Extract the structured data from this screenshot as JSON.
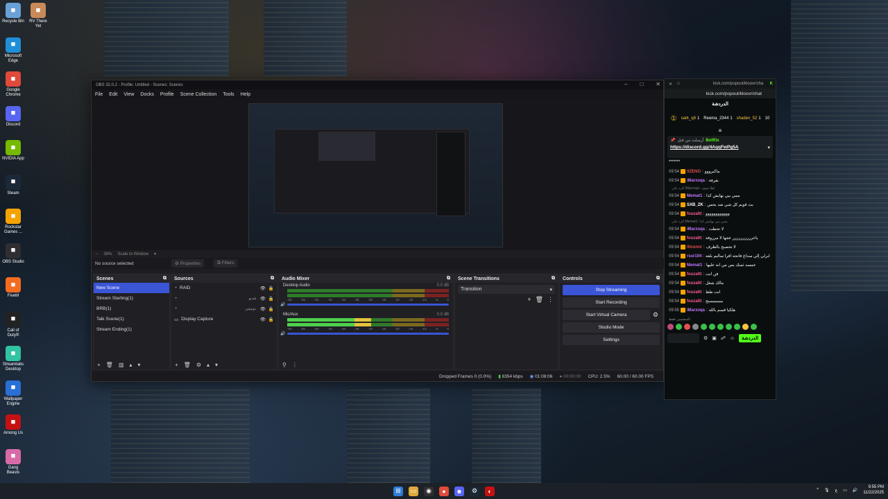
{
  "desktop": {
    "icons": [
      {
        "label": "Recycle Bin",
        "icon": "recycle-bin-icon",
        "color": "#6aa0d8"
      },
      {
        "label": "RV There Yet",
        "icon": "game-icon",
        "color": "#c98a5a"
      },
      {
        "label": "Microsoft Edge",
        "icon": "edge-icon",
        "color": "#1f8fd8"
      },
      {
        "label": "Google Chrome",
        "icon": "chrome-icon",
        "color": "#e04a3a"
      },
      {
        "label": "Discord",
        "icon": "discord-icon",
        "color": "#5865f2"
      },
      {
        "label": "NVIDIA App",
        "icon": "nvidia-icon",
        "color": "#76b900"
      },
      {
        "label": "Steam",
        "icon": "steam-icon",
        "color": "#1b2838"
      },
      {
        "label": "Rockstar Games ...",
        "icon": "rockstar-icon",
        "color": "#f5a300"
      },
      {
        "label": "OBS Studio",
        "icon": "obs-icon",
        "color": "#302e31"
      },
      {
        "label": "FiveM",
        "icon": "fivem-icon",
        "color": "#f36c21"
      },
      {
        "label": "Call of Duty®",
        "icon": "cod-icon",
        "color": "#222222"
      },
      {
        "label": "Streamlabs Desktop",
        "icon": "streamlabs-icon",
        "color": "#31c3a2"
      },
      {
        "label": "Wallpaper Engine",
        "icon": "wallpaper-engine-icon",
        "color": "#2a6fd6"
      },
      {
        "label": "Among Us",
        "icon": "among-us-icon",
        "color": "#c51111"
      },
      {
        "label": "Gang Beasts",
        "icon": "gang-beasts-icon",
        "color": "#d86aa8"
      }
    ]
  },
  "obs": {
    "title": "OBS 32.0.2 - Profile: Untitled - Scenes: Scenes",
    "menu": [
      "File",
      "Edit",
      "View",
      "Docks",
      "Profile",
      "Scene Collection",
      "Tools",
      "Help"
    ],
    "zoom": "38%",
    "scale_mode": "Scale to Window",
    "source_status": "No source selected",
    "properties_label": "Properties",
    "filters_label": "Filters",
    "scenes": {
      "title": "Scenes",
      "items": [
        "New Scene",
        "Stream Starting(1)",
        "BRB(1)",
        "Talk Scene(1)",
        "Stream Ending(1)"
      ],
      "selected": 0
    },
    "sources": {
      "title": "Sources",
      "items": [
        {
          "name": "RAID",
          "tag": ""
        },
        {
          "name": "",
          "tag": "فيديو"
        },
        {
          "name": "",
          "tag": "دونيشن"
        },
        {
          "name": "Display Capture",
          "tag": ""
        }
      ]
    },
    "audio_mixer": {
      "title": "Audio Mixer",
      "channels": [
        {
          "name": "Desktop Audio",
          "db": "0.0 dB",
          "level": 0.0
        },
        {
          "name": "Mic/Aux",
          "db": "0.0 dB",
          "level": 0.52
        }
      ],
      "scale": [
        "-60",
        "-55",
        "-50",
        "-45",
        "-40",
        "-35",
        "-30",
        "-25",
        "-20",
        "-15",
        "-10",
        "-5",
        "0"
      ]
    },
    "scene_transitions": {
      "title": "Scene Transitions",
      "value": "Transition"
    },
    "controls": {
      "title": "Controls",
      "stop_streaming": "Stop Streaming",
      "start_recording": "Start Recording",
      "start_virtual_camera": "Start Virtual Camera",
      "studio_mode": "Studio Mode",
      "settings": "Settings"
    },
    "status": {
      "dropped_frames": "Dropped Frames 0 (0.0%)",
      "bitrate": "8354 kbps",
      "stream_time": "01:08:06",
      "record_time": "00:00:00",
      "cpu": "CPU: 2.5%",
      "fps": "60.00 / 60.00 FPS"
    }
  },
  "chat": {
    "title": "kick.com/popout/kloovr/cha",
    "url": "kick.com/popout/kloovr/chat",
    "header": "الدردشة",
    "top": [
      {
        "name": "sark_q8",
        "count": "1"
      },
      {
        "name": "Reema_2344",
        "count": "1"
      },
      {
        "name": "shaden_52",
        "count": "1"
      }
    ],
    "leader_count": "10",
    "pinned_user": "BotRix",
    "pinned_prefix": "أرسلت من قبل",
    "pinned_link": "https://discord.gg/4AqqFwPg5A",
    "stars": "*******",
    "messages": [
      {
        "time": "09:54",
        "user": "llZENO",
        "color": "#e05050",
        "text": "ماكبرووو",
        "reply": ""
      },
      {
        "time": "09:54",
        "user": "iMarzoqa",
        "color": "#c078ff",
        "text": "بقرفة",
        "reply": ""
      },
      {
        "time": "09:54",
        "user": "Memat1",
        "color": "#c078ff",
        "text": "ممي يبي بهايش كذا",
        "reply": "الرد على iMarzoqa: اهلا ضيف"
      },
      {
        "time": "09:54",
        "user": "SXB_ZK",
        "color": "#ffffff",
        "text": "بث قويم كل شي ضد بحس",
        "reply": ""
      },
      {
        "time": "09:54",
        "user": "fouzaltt",
        "color": "#ff5a9a",
        "text": "وووووووووووو",
        "reply": ""
      },
      {
        "time": "09:54",
        "user": "iMarzoqa",
        "color": "#c078ff",
        "text": "لا تحطت",
        "reply": "الرد على Memat1: ممي يبي بهايش كذا"
      },
      {
        "time": "09:54",
        "user": "fouzaltt",
        "color": "#ff5a9a",
        "text": "ياخرررررررررر عجها لا مرزوقة",
        "reply": ""
      },
      {
        "time": "09:54",
        "user": "lllnonnr",
        "color": "#e05050",
        "text": "لا تحصبح بالظرف",
        "reply": ""
      },
      {
        "time": "09:54",
        "user": "rssr104",
        "color": "#c078ff",
        "text": "ابرلي إلي سداع فاتجه افرا ساليم بلعه",
        "reply": ""
      },
      {
        "time": "09:54",
        "user": "Memat1",
        "color": "#c078ff",
        "text": "عمسد ثمبك بس من انه عليها",
        "reply": ""
      },
      {
        "time": "09:54",
        "user": "fouzaltt",
        "color": "#ff5a9a",
        "text": "فن انت",
        "reply": ""
      },
      {
        "time": "09:54",
        "user": "fouzaltt",
        "color": "#ff5a9a",
        "text": "مالك شغل",
        "reply": ""
      },
      {
        "time": "09:54",
        "user": "fouzaltt",
        "color": "#ff5a9a",
        "text": "انت طظ",
        "reply": ""
      },
      {
        "time": "09:54",
        "user": "fouzaltt",
        "color": "#ff5a9a",
        "text": "ببببببببببببج",
        "reply": ""
      },
      {
        "time": "09:55",
        "user": "iMarzoqa",
        "color": "#c078ff",
        "text": "هلكيا قسم بالله",
        "reply": ""
      }
    ],
    "reactions_label": "المنضمين فقط",
    "send_label": "الدردشة"
  },
  "taskbar": {
    "time": "9:55 PM",
    "date": "11/22/2025",
    "lang": "ع"
  }
}
